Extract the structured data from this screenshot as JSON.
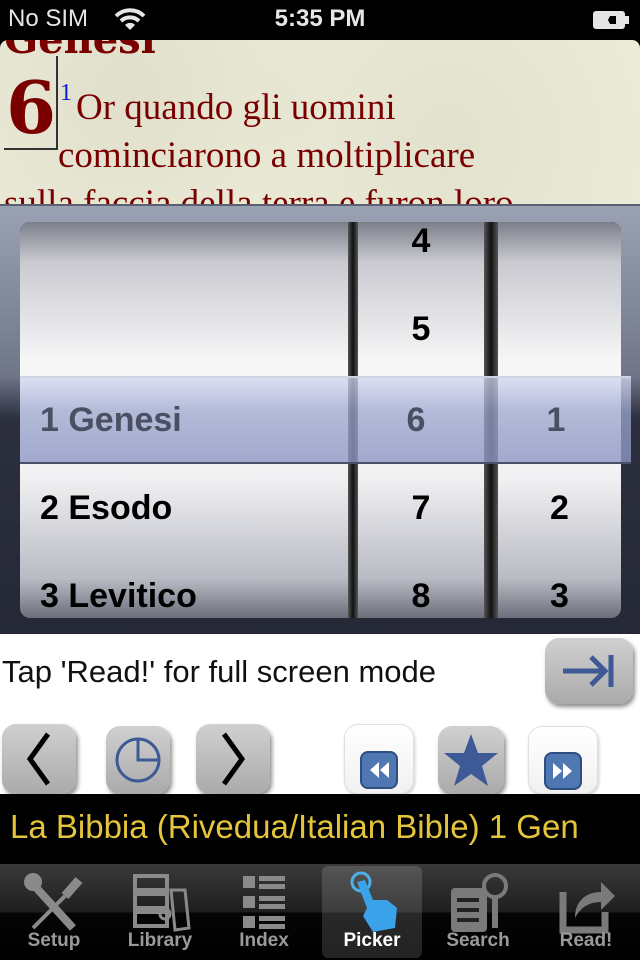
{
  "status_bar": {
    "carrier": "No SIM",
    "time": "5:35 PM",
    "wifi_icon": "wifi-icon",
    "battery_icon": "battery-charging-icon"
  },
  "reader": {
    "book_title": "Genesi",
    "chapter_number": "6",
    "verse_number": "1",
    "lines": [
      "Or quando gli uomini",
      "cominciarono a moltiplicare",
      "sulla faccia della terra e furon loro"
    ]
  },
  "picker": {
    "books": [
      "1 Genesi",
      "2 Esodo",
      "3 Levitico"
    ],
    "chapters": [
      "4",
      "5",
      "6",
      "7",
      "8"
    ],
    "verses": [
      "1",
      "2",
      "3"
    ],
    "selected": {
      "book": "1 Genesi",
      "chapter": "6",
      "verse": "1"
    }
  },
  "info": {
    "hint": "Tap 'Read!' for full screen mode",
    "buttons": {
      "read": "arrow-to-end-icon",
      "prev": "chevron-left-icon",
      "history": "clock-icon",
      "next": "chevron-right-icon",
      "rewind": "rewind-icon",
      "favorite": "star-icon",
      "fast_forward": "fast-forward-icon"
    }
  },
  "title_bar": {
    "text": "La Bibbia (Rivedua/Italian Bible) 1 Gen"
  },
  "tabs": [
    {
      "label": "Setup",
      "icon": "wrench-screwdriver-icon",
      "active": false
    },
    {
      "label": "Library",
      "icon": "library-icon",
      "active": false
    },
    {
      "label": "Index",
      "icon": "list-icon",
      "active": false
    },
    {
      "label": "Picker",
      "icon": "tap-hand-icon",
      "active": true
    },
    {
      "label": "Search",
      "icon": "search-document-icon",
      "active": false
    },
    {
      "label": "Read!",
      "icon": "share-arrow-icon",
      "active": false
    }
  ],
  "colors": {
    "scripture_text": "#7a0000",
    "verse_number": "#0a1ad0",
    "title_bar_text": "#e3c43a",
    "button_icon_blue": "#3d5a96"
  }
}
